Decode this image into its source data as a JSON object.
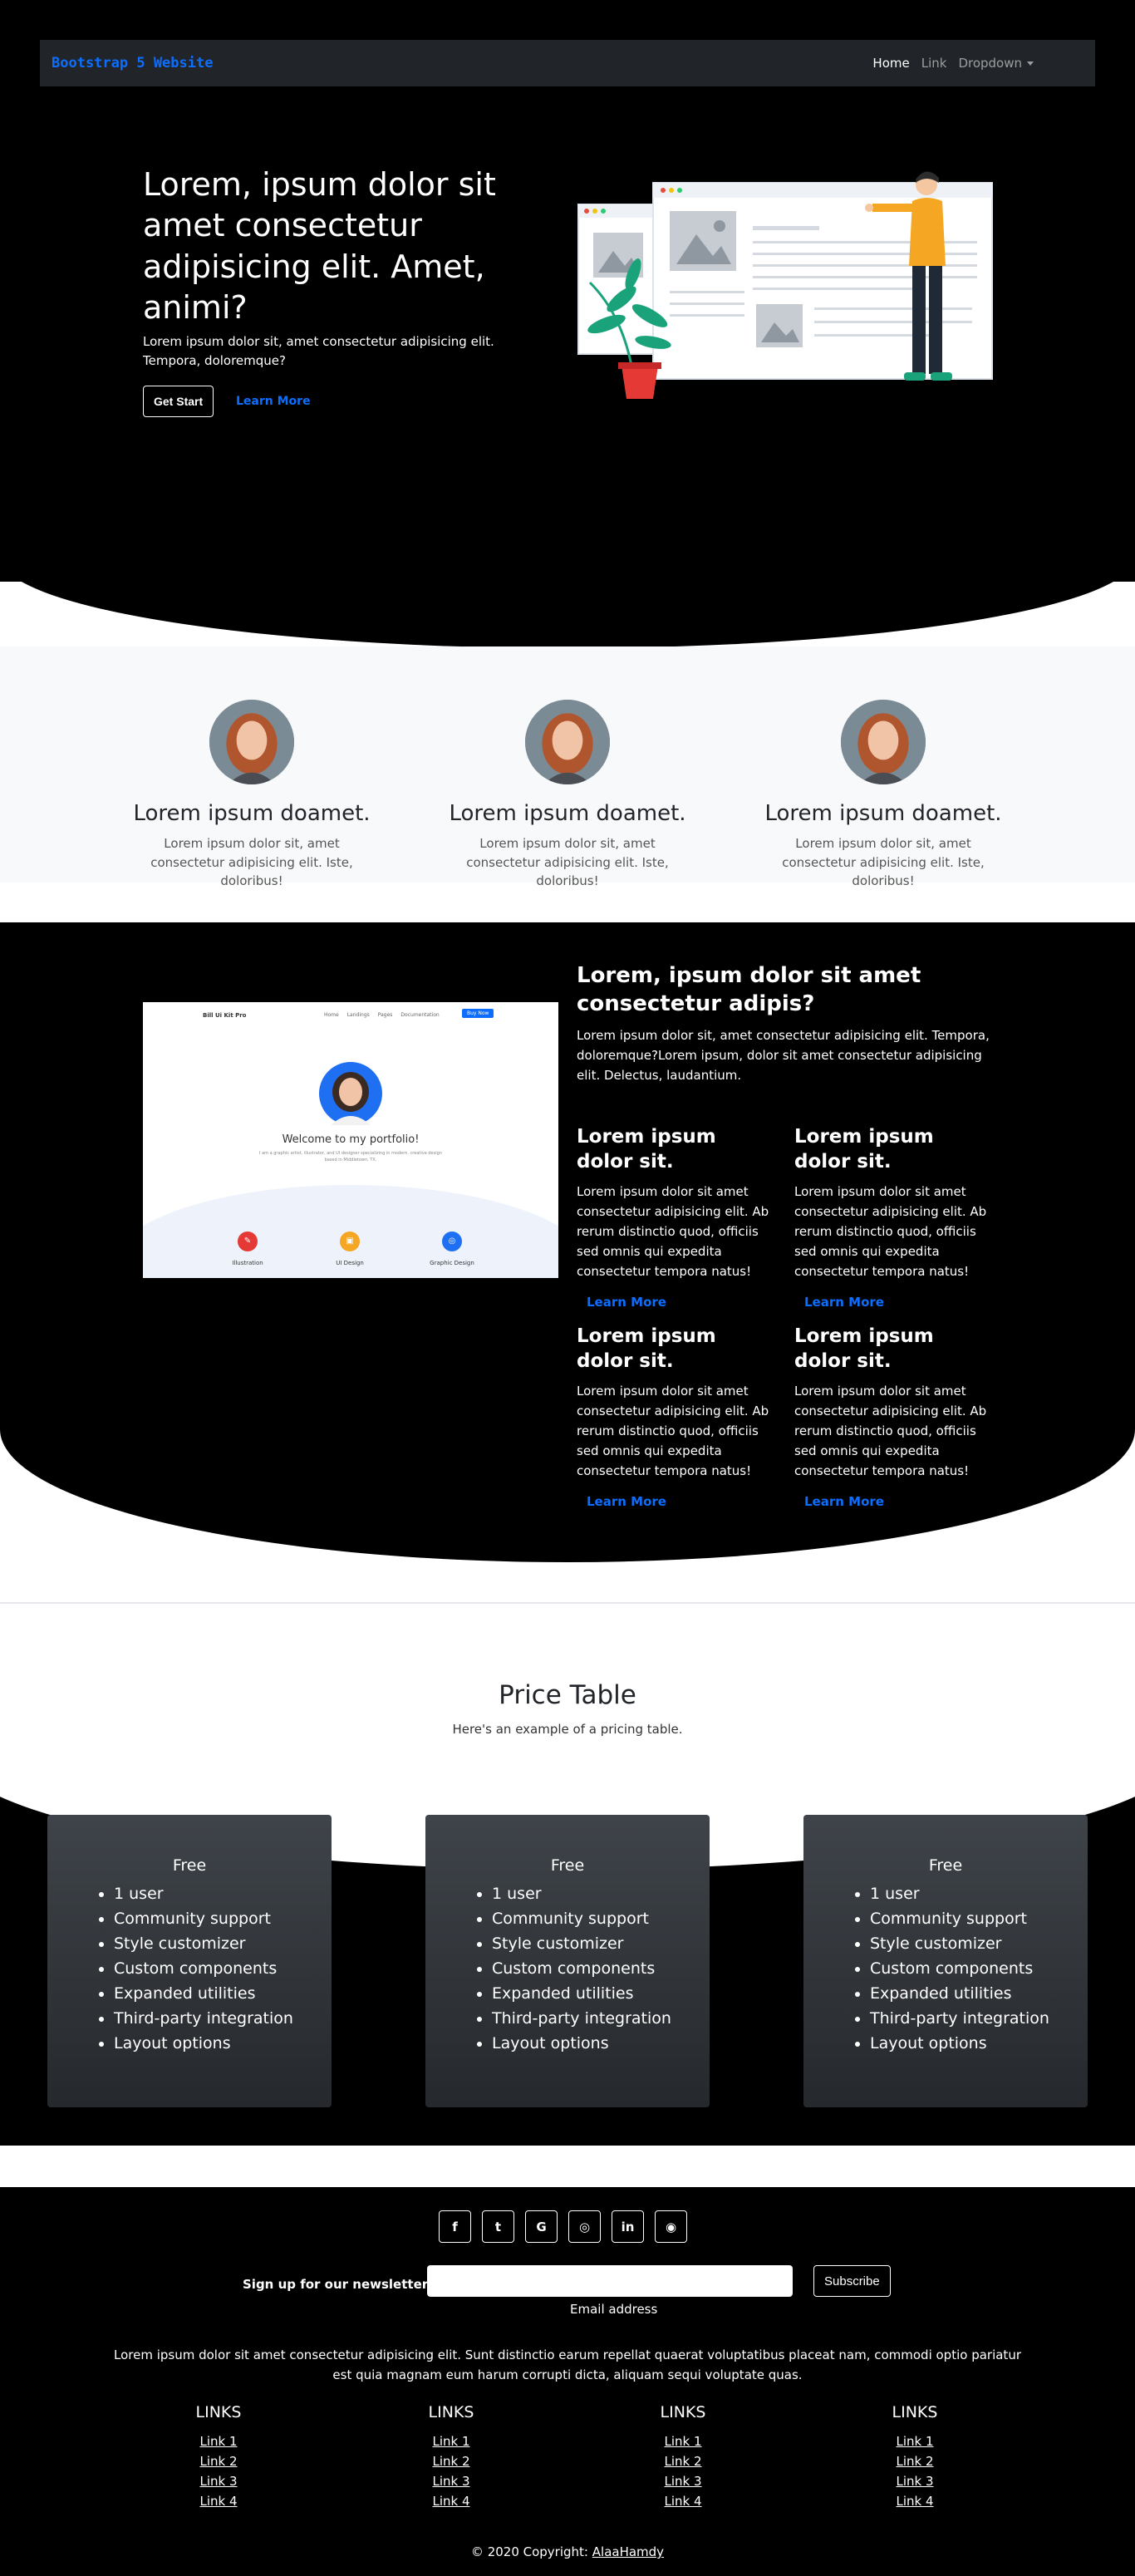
{
  "navbar": {
    "brand": "Bootstrap 5 Website",
    "links": [
      {
        "label": "Home"
      },
      {
        "label": "Link"
      },
      {
        "label": "Dropdown"
      }
    ]
  },
  "hero": {
    "title": "Lorem, ipsum dolor sit amet consectetur adipisicing elit. Amet, animi?",
    "text": "Lorem ipsum dolor sit, amet consectetur adipisicing elit. Tempora, doloremque?",
    "primary_button": "Get Start",
    "secondary_button": "Learn More"
  },
  "team": [
    {
      "name": "Lorem ipsum doamet.",
      "text": "Lorem ipsum dolor sit, amet consectetur adipisicing elit. Iste, doloribus!"
    },
    {
      "name": "Lorem ipsum doamet.",
      "text": "Lorem ipsum dolor sit, amet consectetur adipisicing elit. Iste, doloribus!"
    },
    {
      "name": "Lorem ipsum doamet.",
      "text": "Lorem ipsum dolor sit, amet consectetur adipisicing elit. Iste, doloribus!"
    }
  ],
  "features": {
    "screenshot": {
      "brand": "Bill Ui Kit Pro",
      "nav": [
        "Home",
        "Landings",
        "Pages",
        "Documentation"
      ],
      "button": "Buy Now",
      "heading": "Welcome to my portfolio!",
      "caption": "I am a graphic artist, illustrator, and UI designer specializing in modern, creative design based in Middletown, TX.",
      "services": [
        "Illustration",
        "UI Design",
        "Graphic Design"
      ]
    },
    "title": "Lorem, ipsum dolor sit amet consectetur adipis?",
    "text": "Lorem ipsum dolor sit, amet consectetur adipisicing elit. Tempora, doloremque?Lorem ipsum, dolor sit amet consectetur adipisicing elit. Delectus, laudantium.",
    "items": [
      {
        "title": "Lorem ipsum dolor sit.",
        "text": "Lorem ipsum dolor sit amet consectetur adipisicing elit. Ab rerum distinctio quod, officiis sed omnis qui expedita consectetur tempora natus!",
        "link": "Learn More"
      },
      {
        "title": "Lorem ipsum dolor sit.",
        "text": "Lorem ipsum dolor sit amet consectetur adipisicing elit. Ab rerum distinctio quod, officiis sed omnis qui expedita consectetur tempora natus!",
        "link": "Learn More"
      },
      {
        "title": "Lorem ipsum dolor sit.",
        "text": "Lorem ipsum dolor sit amet consectetur adipisicing elit. Ab rerum distinctio quod, officiis sed omnis qui expedita consectetur tempora natus!",
        "link": "Learn More"
      },
      {
        "title": "Lorem ipsum dolor sit.",
        "text": "Lorem ipsum dolor sit amet consectetur adipisicing elit. Ab rerum distinctio quod, officiis sed omnis qui expedita consectetur tempora natus!",
        "link": "Learn More"
      }
    ]
  },
  "pricing": {
    "title": "Price Table",
    "subtitle": "Here's an example of a pricing table.",
    "plans": [
      {
        "name": "Free",
        "features": [
          "1 user",
          "Community support",
          "Style customizer",
          "Custom components",
          "Expanded utilities",
          "Third-party integration",
          "Layout options"
        ]
      },
      {
        "name": "Free",
        "features": [
          "1 user",
          "Community support",
          "Style customizer",
          "Custom components",
          "Expanded utilities",
          "Third-party integration",
          "Layout options"
        ]
      },
      {
        "name": "Free",
        "features": [
          "1 user",
          "Community support",
          "Style customizer",
          "Custom components",
          "Expanded utilities",
          "Third-party integration",
          "Layout options"
        ]
      }
    ]
  },
  "footer": {
    "socials": [
      {
        "icon": "facebook-icon",
        "glyph": "f"
      },
      {
        "icon": "twitter-icon",
        "glyph": "t"
      },
      {
        "icon": "google-icon",
        "glyph": "G"
      },
      {
        "icon": "instagram-icon",
        "glyph": "◎"
      },
      {
        "icon": "linkedin-icon",
        "glyph": "in"
      },
      {
        "icon": "github-icon",
        "glyph": "◉"
      }
    ],
    "newsletter_label": "Sign up for our newsletter",
    "email_help": "Email address",
    "subscribe_button": "Subscribe",
    "text": "Lorem ipsum dolor sit amet consectetur adipisicing elit. Sunt distinctio earum repellat quaerat voluptatibus placeat nam, commodi optio pariatur est quia magnam eum harum corrupti dicta, aliquam sequi voluptate quas.",
    "link_columns": [
      {
        "title": "LINKS",
        "links": [
          "Link 1",
          "Link 2",
          "Link 3",
          "Link 4"
        ]
      },
      {
        "title": "LINKS",
        "links": [
          "Link 1",
          "Link 2",
          "Link 3",
          "Link 4"
        ]
      },
      {
        "title": "LINKS",
        "links": [
          "Link 1",
          "Link 2",
          "Link 3",
          "Link 4"
        ]
      },
      {
        "title": "LINKS",
        "links": [
          "Link 1",
          "Link 2",
          "Link 3",
          "Link 4"
        ]
      }
    ],
    "copyright_prefix": "© 2020 Copyright:",
    "copyright_link": "AlaaHamdy"
  },
  "colors": {
    "primary": "#0d6efd",
    "dark": "#212529",
    "black": "#000000",
    "light": "#f8f9fa"
  }
}
